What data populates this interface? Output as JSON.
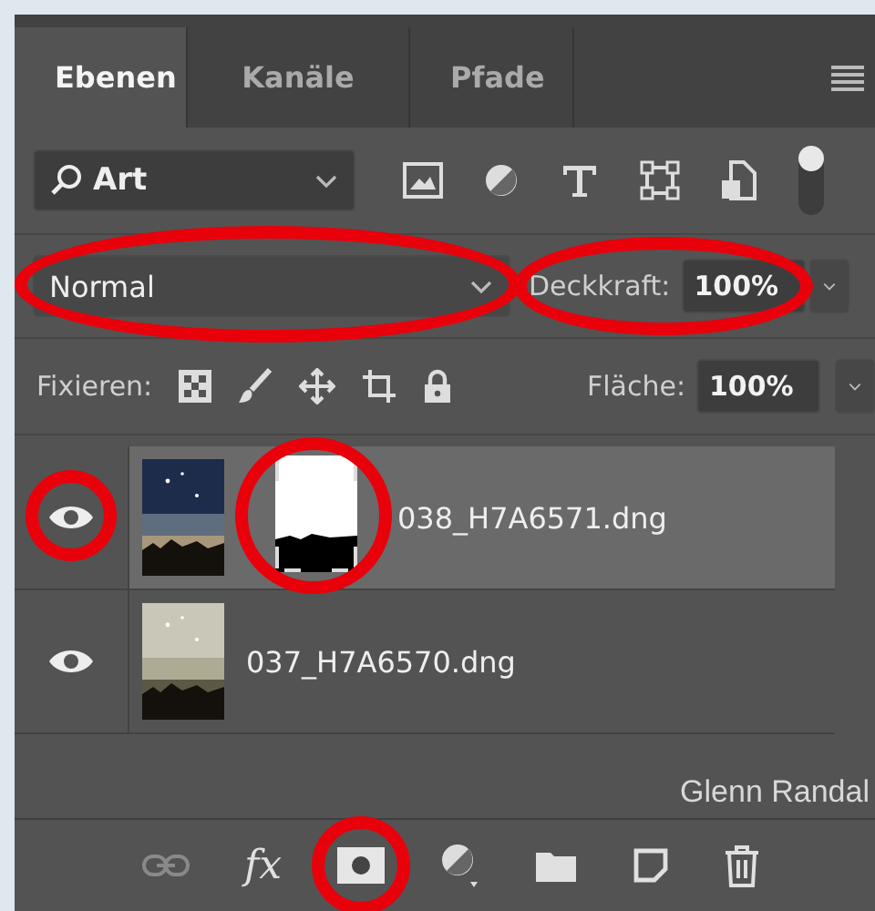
{
  "tabs": [
    {
      "label": "Ebenen",
      "selected": true
    },
    {
      "label": "Kanäle",
      "selected": false
    },
    {
      "label": "Pfade",
      "selected": false
    }
  ],
  "filter": {
    "value": "Art"
  },
  "blend_mode": {
    "value": "Normal",
    "highlighted": true
  },
  "opacity": {
    "label": "Deckkraft:",
    "value": "100%",
    "highlighted": true
  },
  "lock": {
    "label": "Fixieren:"
  },
  "fill": {
    "label": "Fläche:",
    "value": "100%"
  },
  "layers": [
    {
      "name": "038_H7A6571.dng",
      "visible": true,
      "selected": true,
      "has_mask": true,
      "eye_highlighted": true,
      "mask_highlighted": true
    },
    {
      "name": "037_H7A6570.dng",
      "visible": true,
      "selected": false,
      "has_mask": false,
      "eye_highlighted": false,
      "mask_highlighted": false
    }
  ],
  "credit": "Glenn Randal",
  "toolbar": [
    {
      "kind": "link",
      "disabled": true,
      "highlighted": false
    },
    {
      "kind": "fx",
      "label": "fx",
      "disabled": false,
      "highlighted": false
    },
    {
      "kind": "mask",
      "disabled": false,
      "highlighted": true
    },
    {
      "kind": "adjustment",
      "disabled": false,
      "highlighted": false
    },
    {
      "kind": "group",
      "disabled": false,
      "highlighted": false
    },
    {
      "kind": "new",
      "disabled": false,
      "highlighted": false
    },
    {
      "kind": "delete",
      "disabled": false,
      "highlighted": false
    }
  ]
}
